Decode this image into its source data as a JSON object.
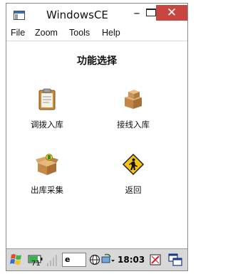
{
  "window": {
    "title": "WindowsCE",
    "minimize": "–",
    "close": "✕"
  },
  "menu": [
    "File",
    "Zoom",
    "Tools",
    "Help"
  ],
  "page": {
    "heading": "功能选择",
    "tiles": [
      {
        "label": "调拨入库",
        "icon": "clipboard-icon"
      },
      {
        "label": "接线入库",
        "icon": "boxes-icon"
      },
      {
        "label": "出库采集",
        "icon": "package-icon"
      },
      {
        "label": "返回",
        "icon": "return-icon"
      }
    ]
  },
  "taskbar": {
    "battery_level": "71",
    "input_box": "e",
    "clock": "18:03",
    "start_icon": "windows-flag-icon"
  },
  "colors": {
    "close_button": "#c7463f",
    "taskbar": "#d8d8d8"
  }
}
